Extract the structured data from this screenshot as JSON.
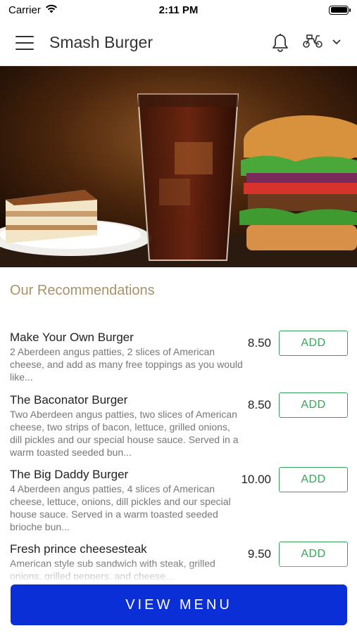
{
  "status": {
    "carrier": "Carrier",
    "time": "2:11 PM"
  },
  "header": {
    "title": "Smash Burger",
    "icons": [
      "menu-icon",
      "bell-icon",
      "scooter-icon",
      "chevron-down-icon"
    ]
  },
  "section": {
    "title": "Our Recommendations"
  },
  "items": [
    {
      "name": "Make Your Own Burger",
      "description": "2 Aberdeen angus patties, 2 slices of American cheese, and add as many free toppings as you would like...",
      "price": "8.50",
      "add_label": "ADD"
    },
    {
      "name": "The Baconator Burger",
      "description": "Two Aberdeen angus patties, two slices of American cheese, two strips of bacon, lettuce, grilled onions, dill pickles and our special house sauce. Served in a warm toasted seeded bun...",
      "price": "8.50",
      "add_label": "ADD"
    },
    {
      "name": "The Big Daddy Burger",
      "description": "4 Aberdeen angus patties, 4 slices of American cheese, lettuce, onions, dill pickles and our special house sauce. Served in a warm toasted seeded brioche bun...",
      "price": "10.00",
      "add_label": "ADD"
    },
    {
      "name": "Fresh prince cheesesteak",
      "description": "American style sub sandwich with steak, grilled onions, grilled peppers, and cheese...",
      "price": "9.50",
      "add_label": "ADD"
    }
  ],
  "footer": {
    "button_label": "VIEW MENU"
  },
  "colors": {
    "accent_green": "#3aa35a",
    "primary_blue": "#0b2fd6",
    "section_gold": "#a8926a"
  }
}
